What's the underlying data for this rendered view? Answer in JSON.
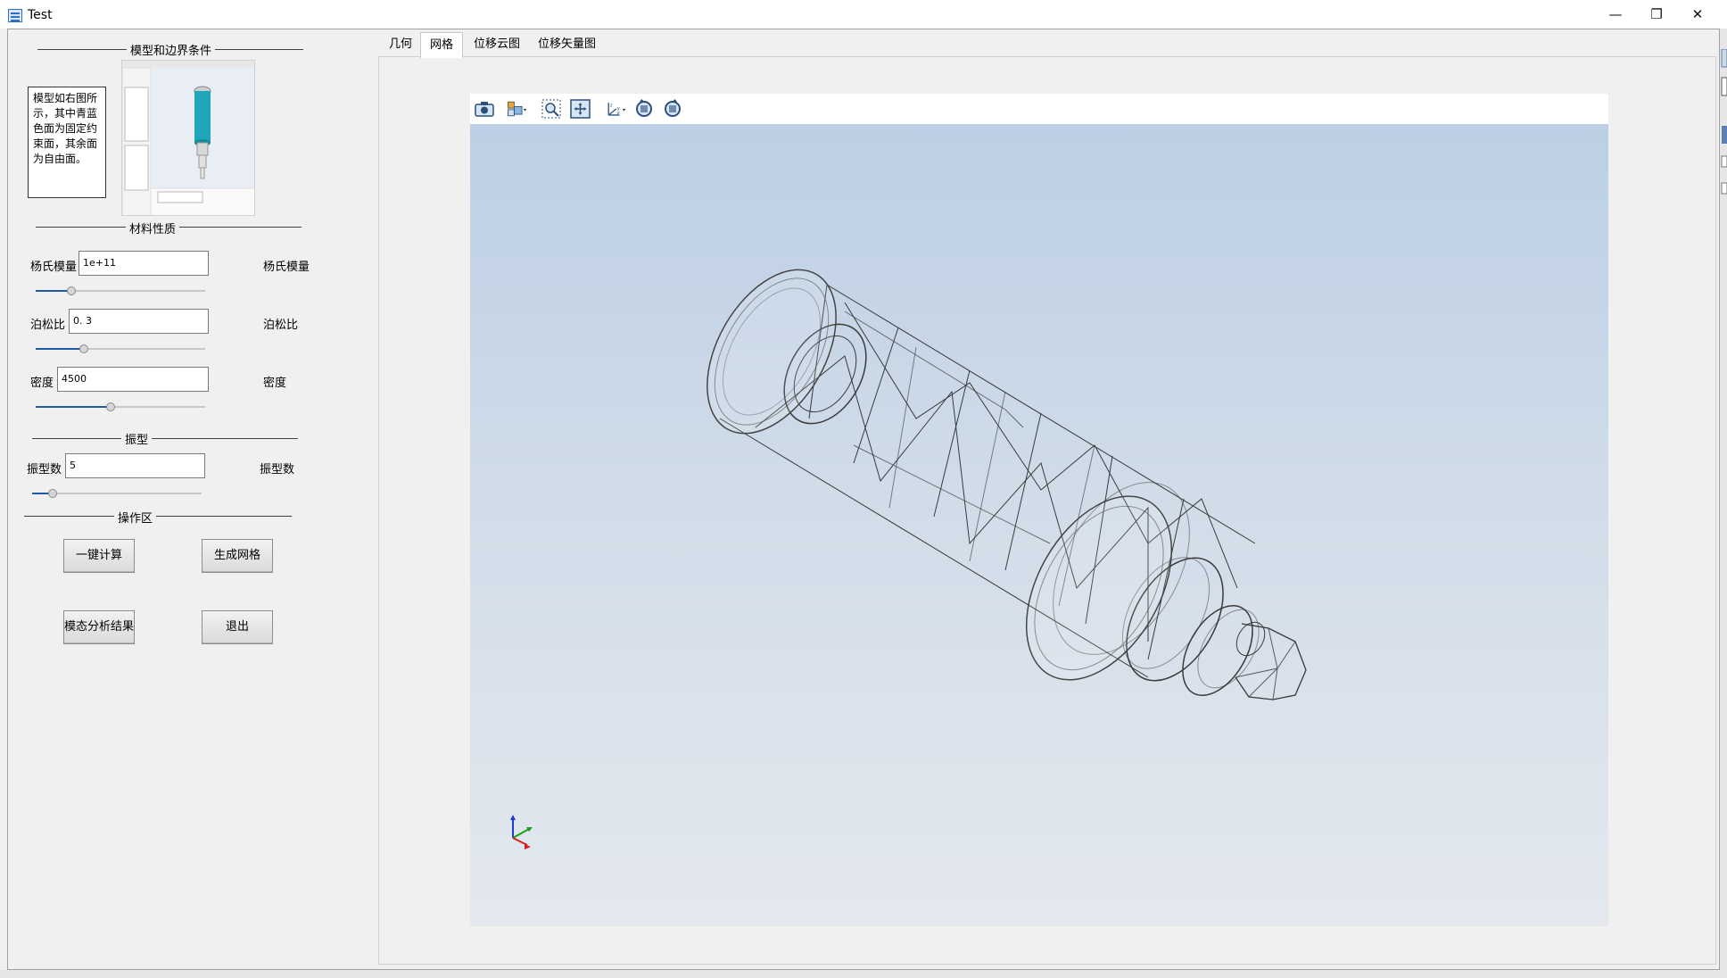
{
  "window": {
    "title": "Test",
    "minimize": "—",
    "maximize": "❐",
    "close": "✕"
  },
  "left_panel": {
    "section_model": "模型和边界条件",
    "description": "模型如右图所示，其中青蓝色面为固定约束面，其余面为自由面。",
    "section_material": "材料性质",
    "youngs_label": "杨氏模量",
    "youngs_value": "1e+11",
    "youngs_unit_label": "杨氏模量",
    "youngs_slider": 0.22,
    "poisson_label": "泊松比",
    "poisson_value": "0. 3",
    "poisson_unit_label": "泊松比",
    "poisson_slider": 0.29,
    "density_label": "密度",
    "density_value": "4500",
    "density_unit_label": "密度",
    "density_slider": 0.44,
    "section_mode": "振型",
    "modes_label": "振型数",
    "modes_value": "5",
    "modes_unit_label": "振型数",
    "modes_slider": 0.12,
    "section_ops": "操作区",
    "btn_compute": "一键计算",
    "btn_mesh": "生成网格",
    "btn_modal": "模态分析结果",
    "btn_exit": "退出"
  },
  "tabs": [
    "几何",
    "网格",
    "位移云图",
    "位移矢量图"
  ],
  "active_tab": "网格",
  "toolbar_icons": [
    "camera-icon",
    "view-cube-icon",
    "zoom-box-icon",
    "fit-all-icon",
    "axes-icon",
    "rotate-left-icon",
    "rotate-right-icon"
  ],
  "colors": {
    "viewport_top": "#bccfe4",
    "viewport_bottom": "#e4e8ee",
    "slider_fill": "#1f5aa6",
    "model_cyan": "#1fa6b8"
  }
}
